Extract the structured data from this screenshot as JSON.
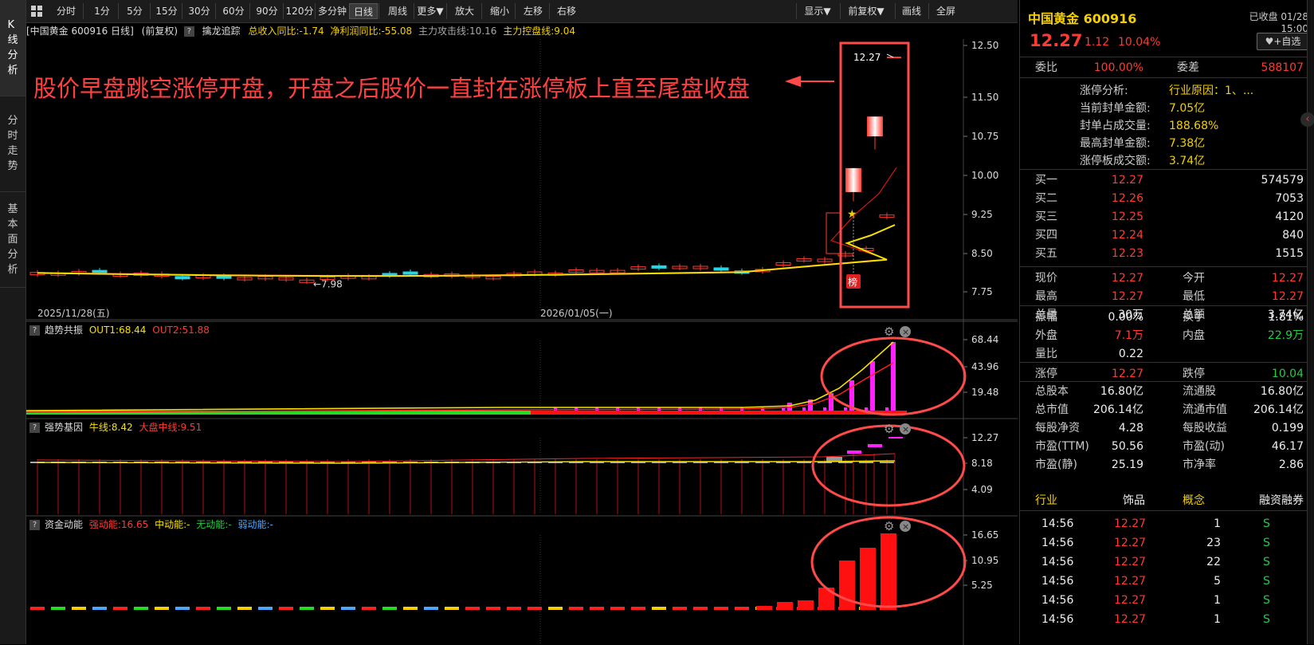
{
  "vtabs": [
    {
      "label": "K线分析",
      "active": true
    },
    {
      "label": "分时走势",
      "active": false
    },
    {
      "label": "基本面分析",
      "active": false
    }
  ],
  "toolbar": {
    "left": [
      {
        "label": "分时"
      },
      {
        "label": "1分"
      },
      {
        "label": "5分"
      },
      {
        "label": "15分"
      },
      {
        "label": "30分"
      },
      {
        "label": "60分"
      },
      {
        "label": "90分"
      },
      {
        "label": "120分"
      },
      {
        "label": "多分钟"
      },
      {
        "label": "日线",
        "active": true
      },
      {
        "label": "周线"
      },
      {
        "label": "更多▼"
      },
      {
        "label": "放大"
      },
      {
        "label": "缩小"
      },
      {
        "label": "左移"
      },
      {
        "label": "右移"
      }
    ],
    "right": [
      {
        "label": "显示▼"
      },
      {
        "label": "前复权▼"
      },
      {
        "label": "画线"
      },
      {
        "label": "全屏"
      }
    ]
  },
  "infoline": {
    "stock": "[中国黄金 600916 日线]",
    "adjust": "(前复权)",
    "indicator": "擒龙追踪",
    "rev_yoy": "总收入同比:-1.74",
    "profit_yoy": "净利润同比:-55.08",
    "attack": "主力攻击线:10.16",
    "control": "主力控盘线:9.04"
  },
  "annotation": {
    "text": "股价早盘跳空涨停开盘，开盘之后股价一直封在涨停板上直至尾盘收盘",
    "color": "#ff4040"
  },
  "main_chart": {
    "yticks": [
      "12.50",
      "11.50",
      "10.75",
      "10.00",
      "9.25",
      "8.50",
      "7.75"
    ],
    "date_left": "2025/11/28(五)",
    "date_mid": "2026/01/05(一)",
    "low_label": "7.98",
    "high_label": "12.27",
    "badge": "榜"
  },
  "panels": {
    "trend": {
      "name": "趋势共振",
      "out1": "OUT1:68.44",
      "out2": "OUT2:51.88",
      "yticks": [
        "68.44",
        "43.96",
        "19.48"
      ]
    },
    "gene": {
      "name": "强势基因",
      "bull": "牛线:8.42",
      "market": "大盘中线:9.51",
      "yticks": [
        "12.27",
        "8.18",
        "4.09"
      ]
    },
    "fund": {
      "name": "资金动能",
      "strong": "强动能:16.65",
      "mid": "中动能:-",
      "none": "无动能:-",
      "weak": "弱动能:-",
      "yticks": [
        "16.65",
        "10.95",
        "5.25"
      ]
    }
  },
  "right": {
    "name": "中国黄金 600916",
    "status": "已收盘 01/28 15:00",
    "price": "12.27",
    "change": "1.12",
    "pct": "10.04%",
    "watch": "+自选",
    "weibi_label": "委比",
    "weibi": "100.00%",
    "weicha_label": "委差",
    "weicha": "588107",
    "limit_analysis": [
      {
        "label": "涨停分析:",
        "value": "行业原因：1、..."
      },
      {
        "label": "当前封单金额:",
        "value": "7.05亿"
      },
      {
        "label": "封单占成交量:",
        "value": "188.68%"
      },
      {
        "label": "最高封单金额:",
        "value": "7.38亿"
      },
      {
        "label": "涨停板成交额:",
        "value": "3.74亿"
      }
    ],
    "bids": [
      {
        "label": "买一",
        "price": "12.27",
        "vol": "574579"
      },
      {
        "label": "买二",
        "price": "12.26",
        "vol": "7053"
      },
      {
        "label": "买三",
        "price": "12.25",
        "vol": "4120"
      },
      {
        "label": "买四",
        "price": "12.24",
        "vol": "840"
      },
      {
        "label": "买五",
        "price": "12.23",
        "vol": "1515"
      }
    ],
    "stats1": [
      {
        "l1": "现价",
        "v1": "12.27",
        "c1": "red",
        "l2": "今开",
        "v2": "12.27",
        "c2": "red"
      },
      {
        "l1": "最高",
        "v1": "12.27",
        "c1": "red",
        "l2": "最低",
        "v2": "12.27",
        "c2": "red"
      },
      {
        "l1": "总量",
        "v1": "30万",
        "c1": "white",
        "l2": "总额",
        "v2": "3.74亿",
        "c2": "white"
      }
    ],
    "stats2": [
      {
        "l1": "振幅",
        "v1": "0.00%",
        "c1": "white",
        "l2": "换手",
        "v2": "1.81%",
        "c2": "white"
      },
      {
        "l1": "外盘",
        "v1": "7.1万",
        "c1": "red",
        "l2": "内盘",
        "v2": "22.9万",
        "c2": "green"
      },
      {
        "l1": "量比",
        "v1": "0.22",
        "c1": "white",
        "l2": "",
        "v2": "",
        "c2": "white"
      }
    ],
    "stats3": [
      {
        "l1": "涨停",
        "v1": "12.27",
        "c1": "red",
        "l2": "跌停",
        "v2": "10.04",
        "c2": "green"
      }
    ],
    "stats4": [
      {
        "l1": "总股本",
        "v1": "16.80亿",
        "c1": "white",
        "l2": "流通股",
        "v2": "16.80亿",
        "c2": "white"
      },
      {
        "l1": "总市值",
        "v1": "206.14亿",
        "c1": "white",
        "l2": "流通市值",
        "v2": "206.14亿",
        "c2": "white"
      },
      {
        "l1": "每股净资",
        "v1": "4.28",
        "c1": "white",
        "l2": "每股收益",
        "v2": "0.199",
        "c2": "white"
      },
      {
        "l1": "市盈(TTM)",
        "v1": "50.56",
        "c1": "white",
        "l2": "市盈(动)",
        "v2": "46.17",
        "c2": "white"
      },
      {
        "l1": "市盈(静)",
        "v1": "25.19",
        "c1": "white",
        "l2": "市净率",
        "v2": "2.86",
        "c2": "white"
      }
    ],
    "tags": {
      "industry_label": "行业",
      "industry": "饰品",
      "concept": "概念",
      "margin": "融资融券"
    },
    "ticks": [
      {
        "time": "14:56",
        "price": "12.27",
        "vol": "1",
        "side": "S"
      },
      {
        "time": "14:56",
        "price": "12.27",
        "vol": "23",
        "side": "S"
      },
      {
        "time": "14:56",
        "price": "12.27",
        "vol": "22",
        "side": "S"
      },
      {
        "time": "14:56",
        "price": "12.27",
        "vol": "5",
        "side": "S"
      },
      {
        "time": "14:56",
        "price": "12.27",
        "vol": "1",
        "side": "S"
      },
      {
        "time": "14:56",
        "price": "12.27",
        "vol": "1",
        "side": "S"
      }
    ]
  },
  "colors": {
    "up": "#ff3b30",
    "down": "#22cc44",
    "cyan": "#22d8e8",
    "ma_yellow": "#f5e000",
    "highlight": "#ff4a4a"
  }
}
